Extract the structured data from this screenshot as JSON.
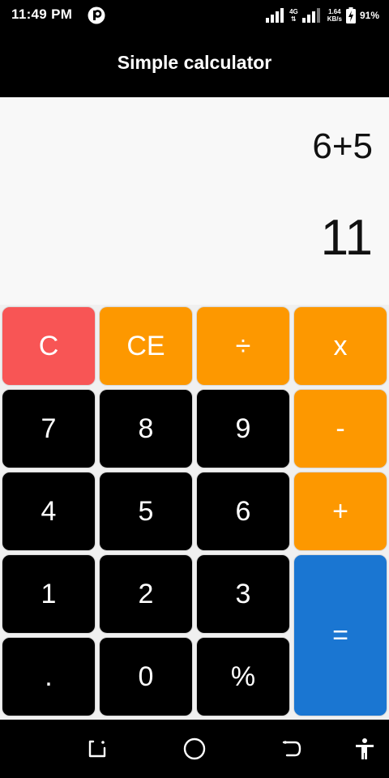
{
  "status_bar": {
    "time": "11:49 PM",
    "network_type": "4G",
    "speed_value": "1.64",
    "speed_unit": "KB/s",
    "battery": "91%"
  },
  "app_bar": {
    "title": "Simple calculator"
  },
  "display": {
    "expression": "6+5",
    "result": "11"
  },
  "keypad": {
    "keys": [
      {
        "label": "C"
      },
      {
        "label": "CE"
      },
      {
        "label": "÷"
      },
      {
        "label": "x"
      },
      {
        "label": "7"
      },
      {
        "label": "8"
      },
      {
        "label": "9"
      },
      {
        "label": "-"
      },
      {
        "label": "4"
      },
      {
        "label": "5"
      },
      {
        "label": "6"
      },
      {
        "label": "+"
      },
      {
        "label": "1"
      },
      {
        "label": "2"
      },
      {
        "label": "3"
      },
      {
        "label": "="
      },
      {
        "label": "."
      },
      {
        "label": "0"
      },
      {
        "label": "%"
      }
    ]
  },
  "colors": {
    "clear": "#f85555",
    "operator": "#fd9800",
    "digit": "#000000",
    "equals": "#1a76d2"
  },
  "nav_bar": {
    "icons": [
      "recent-apps-icon",
      "home-icon",
      "back-icon",
      "accessibility-icon"
    ]
  }
}
